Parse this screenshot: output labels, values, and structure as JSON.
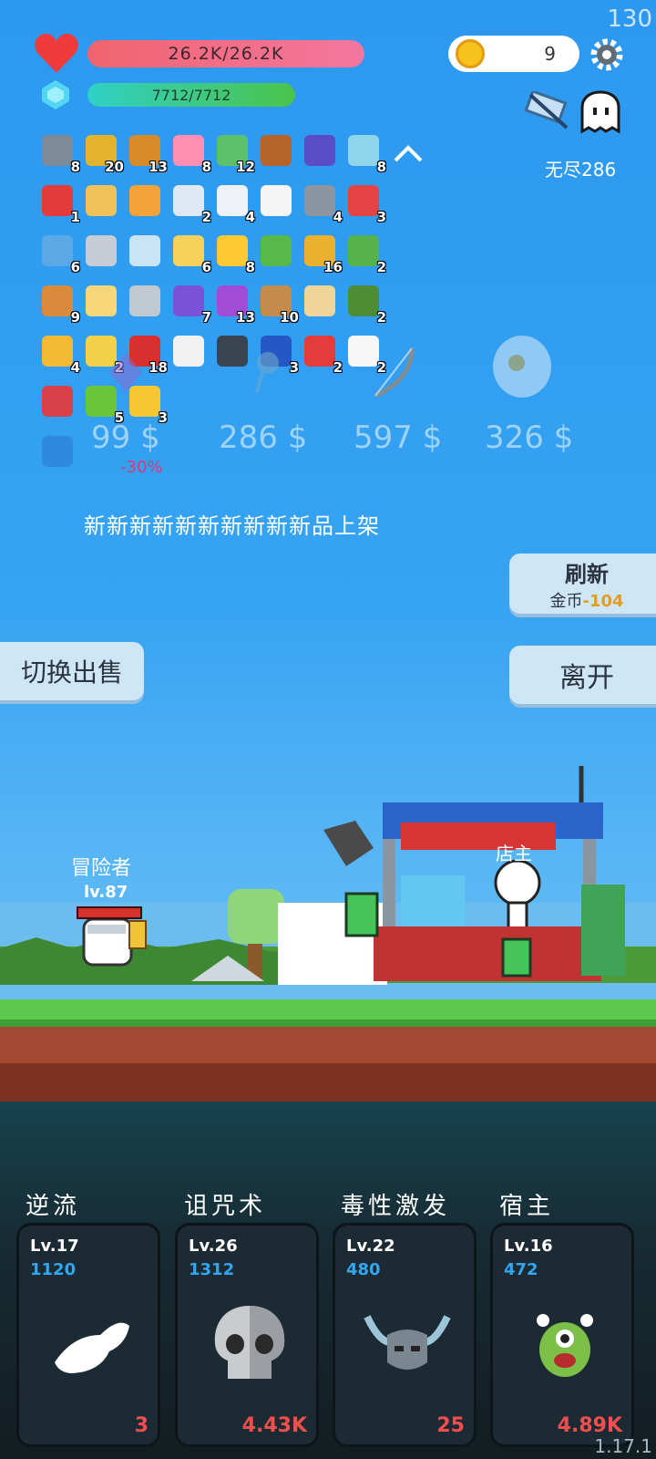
{
  "fps": "130",
  "version": "1.17.1",
  "hud": {
    "hp": "26.2K/26.2K",
    "mp": "7712/7712",
    "coins": "9",
    "endless": "无尽286"
  },
  "inventory": [
    {
      "icon": "dagger-icon",
      "count": "8",
      "color": "#7d8a98"
    },
    {
      "icon": "durian-icon",
      "count": "20",
      "color": "#e4b32d"
    },
    {
      "icon": "book-icon",
      "count": "13",
      "color": "#d68a2a"
    },
    {
      "icon": "ice-cream-icon",
      "count": "8",
      "color": "#ff8fb3"
    },
    {
      "icon": "cash-icon",
      "count": "12",
      "color": "#5cc06a"
    },
    {
      "icon": "drumstick-icon",
      "count": "",
      "color": "#b6652a"
    },
    {
      "icon": "wizard-hat-icon",
      "count": "",
      "color": "#5a4cc4"
    },
    {
      "icon": "syringe-icon",
      "count": "8",
      "color": "#8fd6ea"
    },
    {
      "icon": "strawberry-icon",
      "count": "1",
      "color": "#e33b3b"
    },
    {
      "icon": "scroll-icon",
      "count": "",
      "color": "#f0c25a"
    },
    {
      "icon": "parchment-icon",
      "count": "",
      "color": "#f2a43a"
    },
    {
      "icon": "pill-icon",
      "count": "2",
      "color": "#dfe8f3"
    },
    {
      "icon": "envelope-icon",
      "count": "4",
      "color": "#eef2f6"
    },
    {
      "icon": "clipboard-icon",
      "count": "",
      "color": "#f5f5f5"
    },
    {
      "icon": "spiked-mace-icon",
      "count": "4",
      "color": "#8d96a0"
    },
    {
      "icon": "gift-box-icon",
      "count": "3",
      "color": "#e44343"
    },
    {
      "icon": "star-card-icon",
      "count": "6",
      "color": "#5aa9e6"
    },
    {
      "icon": "hook-icon",
      "count": "",
      "color": "#c7cdd4"
    },
    {
      "icon": "speed-lines-icon",
      "count": "",
      "color": "#c8e4f5"
    },
    {
      "icon": "cheese-icon",
      "count": "6",
      "color": "#f6d15c"
    },
    {
      "icon": "sun-icon",
      "count": "8",
      "color": "#ffc933"
    },
    {
      "icon": "flask-icon",
      "count": "",
      "color": "#59b84a"
    },
    {
      "icon": "pineapple-icon",
      "count": "16",
      "color": "#eab02e"
    },
    {
      "icon": "goblin-icon",
      "count": "2",
      "color": "#56b24a"
    },
    {
      "icon": "briefcase-icon",
      "count": "9",
      "color": "#d98a3a"
    },
    {
      "icon": "note-pencil-icon",
      "count": "",
      "color": "#f7d77a"
    },
    {
      "icon": "compass-icon",
      "count": "",
      "color": "#c0c8d0"
    },
    {
      "icon": "star-chest-icon",
      "count": "7",
      "color": "#7a52d8"
    },
    {
      "icon": "crystal-ball-icon",
      "count": "13",
      "color": "#a04cd6"
    },
    {
      "icon": "crossbow-icon",
      "count": "10",
      "color": "#c38c4a"
    },
    {
      "icon": "treasure-map-icon",
      "count": "",
      "color": "#f0d59a"
    },
    {
      "icon": "grenade-icon",
      "count": "2",
      "color": "#4f8c36"
    },
    {
      "icon": "beer-mug-icon",
      "count": "4",
      "color": "#f3b934"
    },
    {
      "icon": "ring-icon",
      "count": "2",
      "color": "#f3d24a"
    },
    {
      "icon": "mushroom-icon",
      "count": "18",
      "color": "#d92f2f"
    },
    {
      "icon": "playing-cards-icon",
      "count": "",
      "color": "#f1f1f1"
    },
    {
      "icon": "skull-book-icon",
      "count": "",
      "color": "#3a4450"
    },
    {
      "icon": "target-icon",
      "count": "3",
      "color": "#2657c4"
    },
    {
      "icon": "discount-tag-icon",
      "count": "2",
      "color": "#e53b3b"
    },
    {
      "icon": "ghost-icon",
      "count": "2",
      "color": "#f7f7f7"
    },
    {
      "icon": "potion-bottle-icon",
      "count": "",
      "color": "#d8404a"
    },
    {
      "icon": "lime-icon",
      "count": "5",
      "color": "#6cc43a"
    },
    {
      "icon": "magic-wand-icon",
      "count": "3",
      "color": "#f6c733"
    },
    {
      "icon": "lamp-card-icon",
      "count": "",
      "color": "#2e8ae0"
    }
  ],
  "shop": {
    "prices": [
      "99 $",
      "286 $",
      "597 $",
      "326 $"
    ],
    "discount": "-30%",
    "announcement": "新新新新新新新新新新品上架",
    "refresh_label": "刷新",
    "refresh_currency": "金币",
    "refresh_cost": "-104",
    "leave_label": "离开",
    "swap_label": "切换出售",
    "shopkeeper": "店主"
  },
  "adventurer": {
    "name": "冒险者",
    "level": "lv.87",
    "hp_fraction": 1.0
  },
  "skills": [
    {
      "name": "逆流",
      "level": "Lv.17",
      "cost": "1120",
      "count": "3",
      "icon": "wing-icon"
    },
    {
      "name": "诅咒术",
      "level": "Lv.26",
      "cost": "1312",
      "count": "4.43K",
      "icon": "skull-icon"
    },
    {
      "name": "毒性激发",
      "level": "Lv.22",
      "cost": "480",
      "count": "25",
      "icon": "horned-helmet-icon"
    },
    {
      "name": "宿主",
      "level": "Lv.16",
      "cost": "472",
      "count": "4.89K",
      "icon": "eye-monster-icon"
    }
  ]
}
